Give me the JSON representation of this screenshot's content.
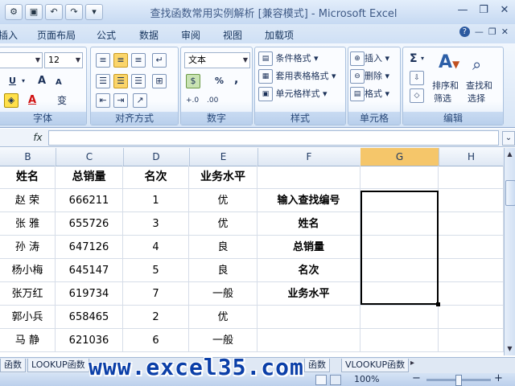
{
  "window": {
    "title": "查找函数常用实例解析  [兼容模式] - Microsoft Excel"
  },
  "tabs": [
    "插入",
    "页面布局",
    "公式",
    "数据",
    "审阅",
    "视图",
    "加载项"
  ],
  "ribbon": {
    "font_group_label": "字体",
    "font_size": "12",
    "underline": "U",
    "grow_font": "A",
    "shrink_font": "A",
    "phonetic": "变",
    "align_group_label": "对齐方式",
    "number_group_label": "数字",
    "number_format": "文本",
    "percent": "%",
    "comma": ",",
    "style_group_label": "样式",
    "cond_format": "条件格式",
    "table_format": "套用表格格式",
    "cell_style": "单元格样式",
    "cells_group_label": "单元格",
    "insert": "插入",
    "delete": "删除",
    "format": "格式",
    "edit_group_label": "编辑",
    "sigma": "Σ",
    "sort_filter_1": "排序和",
    "sort_filter_2": "筛选",
    "find_select_1": "查找和",
    "find_select_2": "选择"
  },
  "formula_bar": {
    "fx": "fx",
    "value": ""
  },
  "columns": [
    "B",
    "C",
    "D",
    "E",
    "F",
    "G",
    "H"
  ],
  "table": {
    "headers": [
      "姓名",
      "总销量",
      "名次",
      "业务水平"
    ],
    "rows": [
      [
        "赵  荣",
        "666211",
        "1",
        "优"
      ],
      [
        "张  雅",
        "655726",
        "3",
        "优"
      ],
      [
        "孙  涛",
        "647126",
        "4",
        "良"
      ],
      [
        "杨小梅",
        "645147",
        "5",
        "良"
      ],
      [
        "张万红",
        "619734",
        "7",
        "一般"
      ],
      [
        "郭小兵",
        "658465",
        "2",
        "优"
      ],
      [
        "马  静",
        "621036",
        "6",
        "一般"
      ]
    ]
  },
  "lookup_labels": [
    "输入查找编号",
    "姓名",
    "总销量",
    "名次",
    "业务水平"
  ],
  "sheet_tabs": [
    "函数",
    "LOOKUP函数",
    "函数",
    "VLOOKUP函数"
  ],
  "status": {
    "zoom": "100%",
    "zoom_minus": "−",
    "zoom_plus": "+"
  },
  "watermark": "www.excel35.com"
}
